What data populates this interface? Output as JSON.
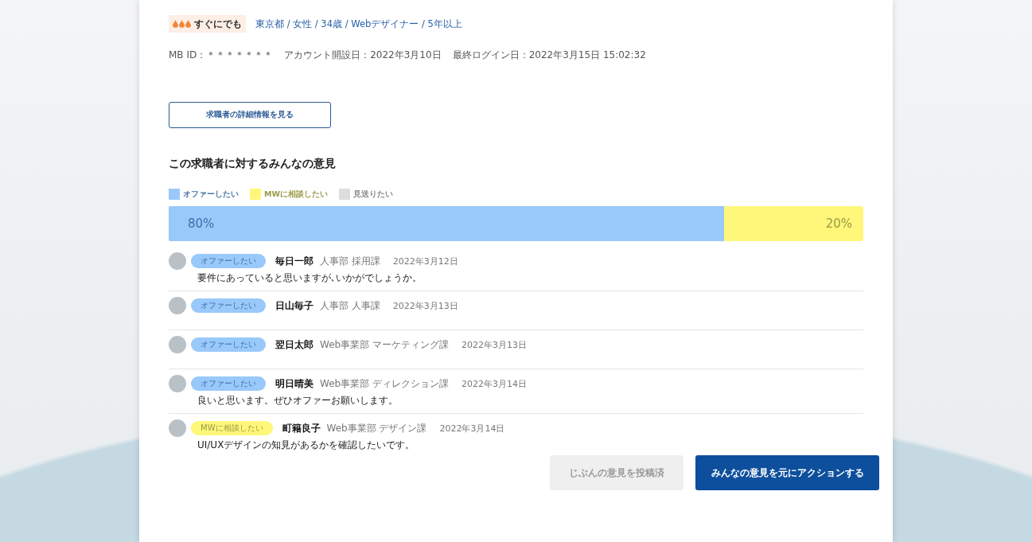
{
  "urgency": {
    "label": "すぐにでも"
  },
  "profile": "東京都 / 女性 / 34歳 / Webデザイナー / 5年以上",
  "meta": [
    "MB ID：＊＊＊＊＊＊＊",
    "アカウント開設日：2022年3月10日",
    "最終ログイン日：2022年3月15日 15:02:32"
  ],
  "detail_button": "求職者の詳細情報を見る",
  "heading": "この求職者に対するみんなの意見",
  "legend": [
    {
      "label": "オファーしたい",
      "color": "#99c9fb"
    },
    {
      "label": "MWに相談したい",
      "color": "#fff77a"
    },
    {
      "label": "見送りたい",
      "color": "#dddddd"
    }
  ],
  "bar": {
    "level": 0.8,
    "readings": [
      "80%",
      "20%"
    ]
  },
  "comments": [
    {
      "tag": "オファーしたい",
      "kind": "offer",
      "name": "毎日一郎",
      "dept": "人事部 採用課",
      "date": "2022年3月12日",
      "text": "要件にあっていると思いますが､いかがでしょうか。"
    },
    {
      "tag": "オファーしたい",
      "kind": "offer",
      "name": "日山毎子",
      "dept": "人事部 人事課",
      "date": "2022年3月13日"
    },
    {
      "tag": "オファーしたい",
      "kind": "offer",
      "name": "翌日太郎",
      "dept": "Web事業部 マーケティング課",
      "date": "2022年3月13日"
    },
    {
      "tag": "オファーしたい",
      "kind": "offer",
      "name": "明日晴美",
      "dept": "Web事業部 ディレクション課",
      "date": "2022年3月14日",
      "text": "良いと思います。ぜひオファーお願いします。"
    },
    {
      "tag": "MWに相談したい",
      "kind": "consult",
      "name": "町籍良子",
      "dept": "Web事業部 デザイン課",
      "date": "2022年3月14日",
      "text": "UI/UXデザインの知見があるかを確認したいです。"
    }
  ],
  "actions": [
    {
      "label": "じぶんの意見を投稿済",
      "disabled": true
    },
    {
      "label": "みんなの意見を元にアクションする",
      "disabled": false
    }
  ]
}
